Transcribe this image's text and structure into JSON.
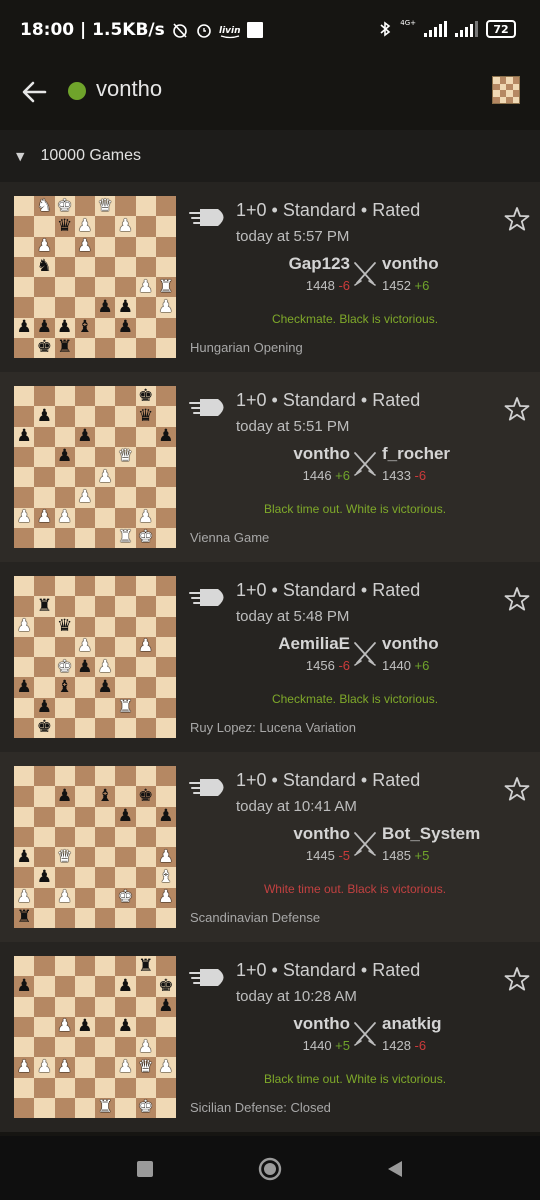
{
  "status_bar": {
    "time_speed": "18:00 | 1.5KB/s",
    "network_label": "4G+",
    "battery": "72",
    "icons": [
      "alarm-off-icon",
      "alarm-icon",
      "app-notification-icon",
      "square-icon",
      "bluetooth-icon",
      "signal-icon",
      "signal-icon",
      "battery-icon"
    ]
  },
  "header": {
    "title": "vontho",
    "online_color": "#6fa42b",
    "back_icon": "arrow-left-icon",
    "board_icon": "chessboard-icon"
  },
  "section": {
    "label": "10000 Games",
    "caret": "▼"
  },
  "colors": {
    "positive": "#6fa42b",
    "negative": "#cc3b3b",
    "row_a": "#262421",
    "row_b": "#2e2b27"
  },
  "games": [
    {
      "meta": "1+0 • Standard • Rated",
      "time": "today at 5:57 PM",
      "white": {
        "name": "Gap123",
        "rating": "1448",
        "diff": "-6",
        "diff_sign": "neg"
      },
      "black": {
        "name": "vontho",
        "rating": "1452",
        "diff": "+6",
        "diff_sign": "pos"
      },
      "result": "Checkmate. Black is victorious.",
      "result_type": "win",
      "opening": "Hungarian Opening",
      "board": [
        [
          "",
          "N",
          "K",
          "",
          "Q",
          "",
          "",
          ""
        ],
        [
          "",
          "",
          "q",
          "P",
          "",
          "P",
          "",
          ""
        ],
        [
          "",
          "P",
          "",
          "P",
          "",
          "",
          "",
          ""
        ],
        [
          "",
          "n",
          "",
          "",
          "",
          "",
          "",
          ""
        ],
        [
          "",
          "",
          "",
          "",
          "",
          "",
          "P",
          "R"
        ],
        [
          "",
          "",
          "",
          "",
          "p",
          "p",
          "",
          "P"
        ],
        [
          "p",
          "p",
          "p",
          "b",
          "",
          "p",
          "",
          ""
        ],
        [
          "",
          "k",
          "r",
          "",
          "",
          "",
          "",
          ""
        ]
      ]
    },
    {
      "meta": "1+0 • Standard • Rated",
      "time": "today at 5:51 PM",
      "white": {
        "name": "vontho",
        "rating": "1446",
        "diff": "+6",
        "diff_sign": "pos"
      },
      "black": {
        "name": "f_rocher",
        "rating": "1433",
        "diff": "-6",
        "diff_sign": "neg"
      },
      "result": "Black time out. White is victorious.",
      "result_type": "win",
      "opening": "Vienna Game",
      "board": [
        [
          "",
          "",
          "",
          "",
          "",
          "",
          "k",
          ""
        ],
        [
          "",
          "p",
          "",
          "",
          "",
          "",
          "q",
          ""
        ],
        [
          "p",
          "",
          "",
          "p",
          "",
          "",
          "",
          "p"
        ],
        [
          "",
          "",
          "p",
          "",
          "",
          "Q",
          "",
          ""
        ],
        [
          "",
          "",
          "",
          "",
          "P",
          "",
          "",
          ""
        ],
        [
          "",
          "",
          "",
          "P",
          "",
          "",
          "",
          ""
        ],
        [
          "P",
          "P",
          "P",
          "",
          "",
          "",
          "P",
          ""
        ],
        [
          "",
          "",
          "",
          "",
          "",
          "R",
          "K",
          ""
        ]
      ]
    },
    {
      "meta": "1+0 • Standard • Rated",
      "time": "today at 5:48 PM",
      "white": {
        "name": "AemiliaE",
        "rating": "1456",
        "diff": "-6",
        "diff_sign": "neg"
      },
      "black": {
        "name": "vontho",
        "rating": "1440",
        "diff": "+6",
        "diff_sign": "pos"
      },
      "result": "Checkmate. Black is victorious.",
      "result_type": "win",
      "opening": "Ruy Lopez: Lucena Variation",
      "board": [
        [
          "",
          "",
          "",
          "",
          "",
          "",
          "",
          ""
        ],
        [
          "",
          "r",
          "",
          "",
          "",
          "",
          "",
          ""
        ],
        [
          "P",
          "",
          "q",
          "",
          "",
          "",
          "",
          ""
        ],
        [
          "",
          "",
          "",
          "P",
          "",
          "",
          "P",
          ""
        ],
        [
          "",
          "",
          "K",
          "p",
          "P",
          "",
          "",
          ""
        ],
        [
          "p",
          "",
          "b",
          "",
          "p",
          "",
          "",
          ""
        ],
        [
          "",
          "p",
          "",
          "",
          "",
          "R",
          "",
          ""
        ],
        [
          "",
          "k",
          "",
          "",
          "",
          "",
          "",
          ""
        ]
      ]
    },
    {
      "meta": "1+0 • Standard • Rated",
      "time": "today at 10:41 AM",
      "white": {
        "name": "vontho",
        "rating": "1445",
        "diff": "-5",
        "diff_sign": "neg"
      },
      "black": {
        "name": "Bot_System",
        "rating": "1485",
        "diff": "+5",
        "diff_sign": "pos"
      },
      "result": "White time out. Black is victorious.",
      "result_type": "loss",
      "opening": "Scandinavian Defense",
      "board": [
        [
          "",
          "",
          "",
          "",
          "",
          "",
          "",
          ""
        ],
        [
          "",
          "",
          "p",
          "",
          "b",
          "",
          "k",
          ""
        ],
        [
          "",
          "",
          "",
          "",
          "",
          "p",
          "",
          "p"
        ],
        [
          "",
          "",
          "",
          "",
          "",
          "",
          "",
          ""
        ],
        [
          "p",
          "",
          "Q",
          "",
          "",
          "",
          "",
          "P"
        ],
        [
          "",
          "p",
          "",
          "",
          "",
          "",
          "",
          "B"
        ],
        [
          "P",
          "",
          "P",
          "",
          "",
          "K",
          "",
          "P"
        ],
        [
          "r",
          "",
          "",
          "",
          "",
          "",
          "",
          ""
        ]
      ]
    },
    {
      "meta": "1+0 • Standard • Rated",
      "time": "today at 10:28 AM",
      "white": {
        "name": "vontho",
        "rating": "1440",
        "diff": "+5",
        "diff_sign": "pos"
      },
      "black": {
        "name": "anatkig",
        "rating": "1428",
        "diff": "-6",
        "diff_sign": "neg"
      },
      "result": "Black time out. White is victorious.",
      "result_type": "win",
      "opening": "Sicilian Defense: Closed",
      "board": [
        [
          "",
          "",
          "",
          "",
          "",
          "",
          "r",
          ""
        ],
        [
          "p",
          "",
          "",
          "",
          "",
          "p",
          "",
          "k"
        ],
        [
          "",
          "",
          "",
          "",
          "",
          "",
          "",
          "p"
        ],
        [
          "",
          "",
          "P",
          "p",
          "",
          "p",
          "",
          ""
        ],
        [
          "",
          "",
          "",
          "",
          "",
          "",
          "P",
          ""
        ],
        [
          "P",
          "P",
          "P",
          "",
          "",
          "P",
          "Q",
          "P"
        ],
        [
          "",
          "",
          "",
          "",
          "",
          "",
          "",
          ""
        ],
        [
          "",
          "",
          "",
          "",
          "R",
          "",
          "K",
          ""
        ]
      ]
    }
  ],
  "nav": {
    "icons": [
      "square-recent-icon",
      "home-circle-icon",
      "triangle-back-icon"
    ]
  }
}
